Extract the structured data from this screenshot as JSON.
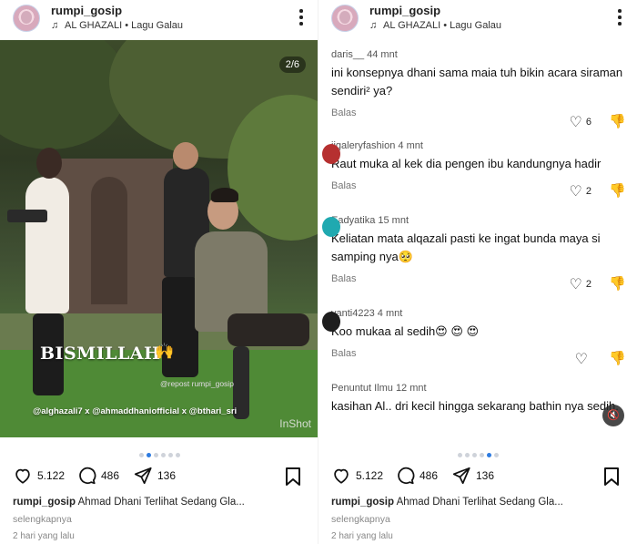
{
  "header": {
    "username": "rumpi_gosip",
    "song_artist": "AL GHAZALI",
    "song_separator": "•",
    "song_title": "Lagu Galau"
  },
  "media": {
    "counter": "2/6",
    "overlay_title": "BISMILLAH",
    "overlay_tags": "@alghazali7 x @ahmaddhaniofficial x @bthari_sri",
    "repost": "@repost rumpi_gosip",
    "watermark": "InShot"
  },
  "comments": [
    {
      "user": "daris__",
      "time": "44 mnt",
      "text": "ini konsepnya dhani sama maia tuh bikin acara siraman sendiri² ya?",
      "reply": "Balas",
      "likes": "6"
    },
    {
      "user": "jjgaleryfashion",
      "time": "4 mnt",
      "text": "Raut muka al kek dia pengen ibu kandungnya hadir",
      "reply": "Balas",
      "likes": "2"
    },
    {
      "user": "Eadyatika",
      "time": "15 mnt",
      "text": "Keliatan mata alqazali pasti ke ingat bunda maya si samping nya🥺",
      "reply": "Balas",
      "likes": "2"
    },
    {
      "user": "yanti4223",
      "time": "4 mnt",
      "text": "Koo mukaa al sedih😍 😍 😍",
      "reply": "Balas",
      "likes": ""
    },
    {
      "user": "Penuntut Ilmu",
      "time": "12 mnt",
      "text": "kasihan Al.. dri kecil hingga sekarang bathin nya sedih.",
      "reply": "",
      "likes": ""
    }
  ],
  "actions": {
    "likes": "5.122",
    "comments": "486",
    "shares": "136"
  },
  "caption": {
    "username": "rumpi_gosip",
    "text": "Ahmad Dhani Terlihat Sedang Gla...",
    "see_more": "selengkapnya",
    "time": "2 hari yang lalu"
  },
  "carousel": {
    "total": 6,
    "active_index": 1
  },
  "colors": {
    "accent": "#2d7be0",
    "bismillah_hands": "#f2c23b"
  }
}
